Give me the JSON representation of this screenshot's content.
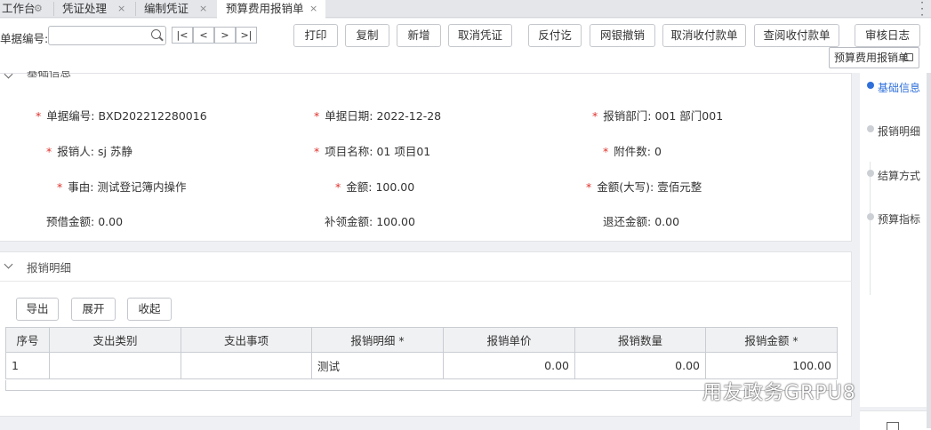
{
  "tabs": [
    {
      "label": "工作台",
      "close": "⚙"
    },
    {
      "label": "凭证处理",
      "close": "×"
    },
    {
      "label": "编制凭证",
      "close": "×"
    },
    {
      "label": "预算费用报销单",
      "close": "×"
    }
  ],
  "toolbar": {
    "doc_no_label": "单据编号:",
    "search_value": "",
    "nav": [
      "|<",
      "<",
      ">",
      ">|"
    ],
    "buttons": [
      "打印",
      "复制",
      "新增",
      "取消凭证",
      "反付讫",
      "网银撤销",
      "取消收付款单",
      "查阅收付款单",
      "审核日志"
    ],
    "print_template": "预算费用报销单"
  },
  "basic": {
    "title": "基础信息",
    "fields": [
      {
        "label": "单据编号:",
        "value": "BXD202212280016",
        "required": true
      },
      {
        "label": "单据日期:",
        "value": "2022-12-28",
        "required": true
      },
      {
        "label": "报销部门:",
        "value": "001 部门001",
        "required": true
      },
      {
        "label": "报销人:",
        "value": "sj 苏静",
        "required": true
      },
      {
        "label": "项目名称:",
        "value": "01 项目01",
        "required": true
      },
      {
        "label": "附件数:",
        "value": "0",
        "required": true
      },
      {
        "label": "事由:",
        "value": "测试登记簿内操作",
        "required": true
      },
      {
        "label": "金额:",
        "value": "100.00",
        "required": true
      },
      {
        "label": "金额(大写):",
        "value": "壹佰元整",
        "required": true
      },
      {
        "label": "预借金额:",
        "value": "0.00",
        "required": false
      },
      {
        "label": "补领金额:",
        "value": "100.00",
        "required": false
      },
      {
        "label": "退还金额:",
        "value": "0.00",
        "required": false
      }
    ]
  },
  "detail": {
    "title": "报销明细",
    "buttons": [
      "导出",
      "展开",
      "收起"
    ],
    "columns": [
      "序号",
      "支出类别",
      "支出事项",
      "报销明细 *",
      "报销单价",
      "报销数量",
      "报销金额 *"
    ],
    "rows": [
      [
        "1",
        "",
        "",
        "测试",
        "0.00",
        "0.00",
        "100.00"
      ]
    ]
  },
  "side_nav": [
    {
      "label": "基础信息",
      "active": true
    },
    {
      "label": "报销明细",
      "active": false
    },
    {
      "label": "结算方式",
      "active": false
    },
    {
      "label": "预算指标",
      "active": false
    }
  ],
  "watermark": "用友政务GRPU8"
}
